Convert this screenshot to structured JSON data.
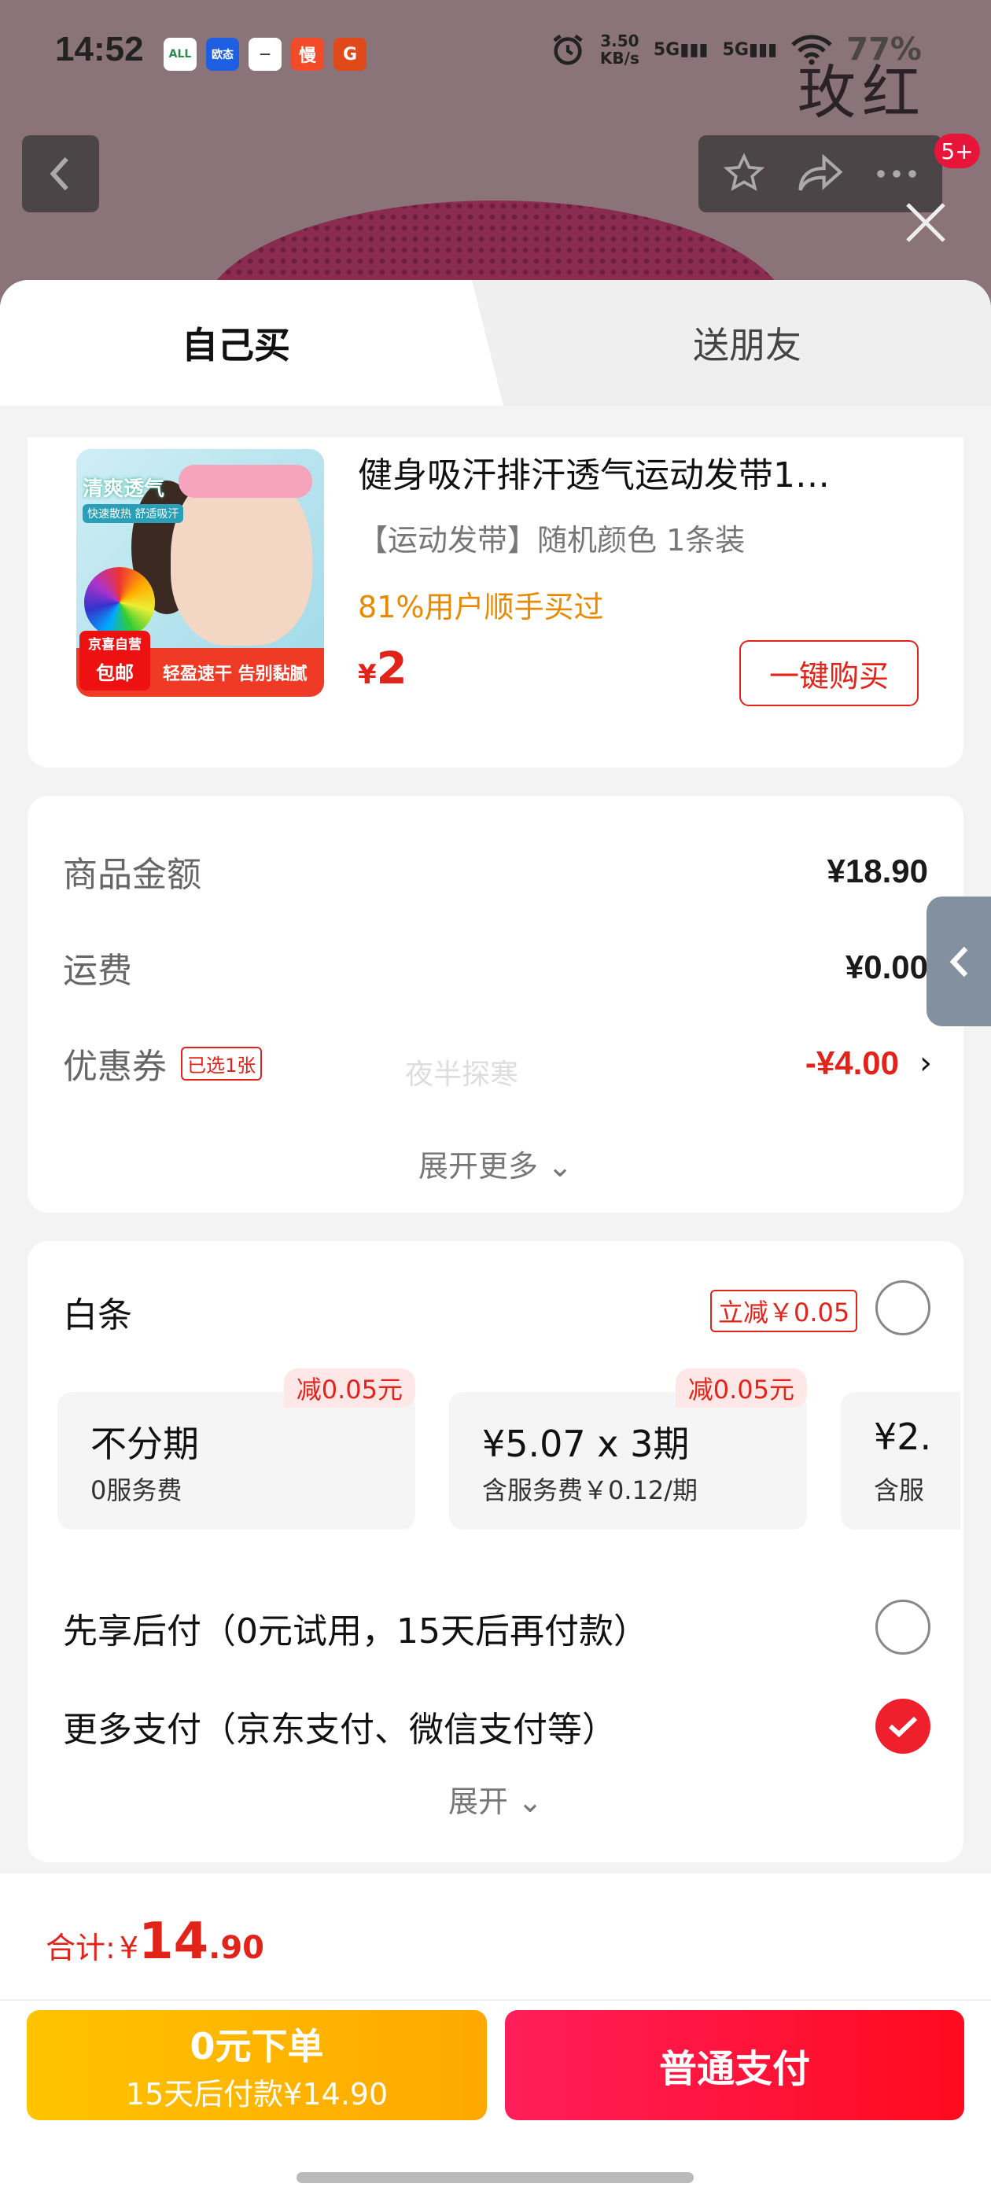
{
  "status_bar": {
    "time": "14:52",
    "speed_value": "3.50",
    "speed_unit": "KB/s",
    "signal1": "5G",
    "signal2": "5G",
    "battery": "77%",
    "apps": [
      {
        "label": "ALL",
        "color": "#ffffff",
        "text_color": "#2a8a4a"
      },
      {
        "label": "欧态",
        "color": "#1d5fe0",
        "text_color": "#ffffff"
      },
      {
        "label": "—",
        "color": "#ffffff",
        "text_color": "#333333"
      },
      {
        "label": "慢",
        "color": "#f24b2a",
        "text_color": "#ffffff"
      },
      {
        "label": "G",
        "color": "#e04a1a",
        "text_color": "#ffffff"
      }
    ]
  },
  "background": {
    "color_label": "玫红",
    "badge": "5+"
  },
  "tabs": {
    "self": "自己买",
    "friend": "送朋友"
  },
  "product": {
    "title": "健身吸汗排汗透气运动发带1…",
    "spec": "【运动发带】随机颜色 1条装",
    "buy_rate": "81%用户顺手买过",
    "price_symbol": "¥",
    "price": "2",
    "buy_button": "一键购买",
    "image_text": {
      "headline": "清爽透气",
      "sub": "快速散热 舒适吸汗",
      "strip": "轻盈速干 告别黏腻",
      "tag_top": "京喜自营",
      "tag_bottom": "包邮"
    }
  },
  "amounts": {
    "goods_label": "商品金额",
    "goods_value": "¥18.90",
    "shipping_label": "运费",
    "shipping_value": "¥0.00",
    "coupon_label": "优惠券",
    "coupon_tag": "已选1张",
    "coupon_value": "-¥4.00",
    "watermark": "夜半探寒",
    "expand_more": "展开更多"
  },
  "payment": {
    "baitiao_label": "白条",
    "baitiao_discount": "立减￥0.05",
    "plans": [
      {
        "title": "不分期",
        "sub": "0服务费",
        "tag": "减0.05元"
      },
      {
        "title": "¥5.07 x 3期",
        "sub": "含服务费￥0.12/期",
        "tag": "减0.05元"
      },
      {
        "title": "¥2.",
        "sub": "含服",
        "tag": ""
      }
    ],
    "later_pay": "先享后付（0元试用，15天后再付款）",
    "more_pay": "更多支付（京东支付、微信支付等）",
    "expand": "展开"
  },
  "bottom": {
    "total_label": "合计:",
    "total_currency": "¥",
    "total_int": "14",
    "total_dec": ".90",
    "zero_order_line1": "0元下单",
    "zero_order_line2": "15天后付款¥14.90",
    "pay_button": "普通支付"
  },
  "colors": {
    "accent_red": "#e2231a",
    "orange": "#e88a00",
    "zero_btn": "#ffb400",
    "pay_btn": "#ff1430"
  }
}
